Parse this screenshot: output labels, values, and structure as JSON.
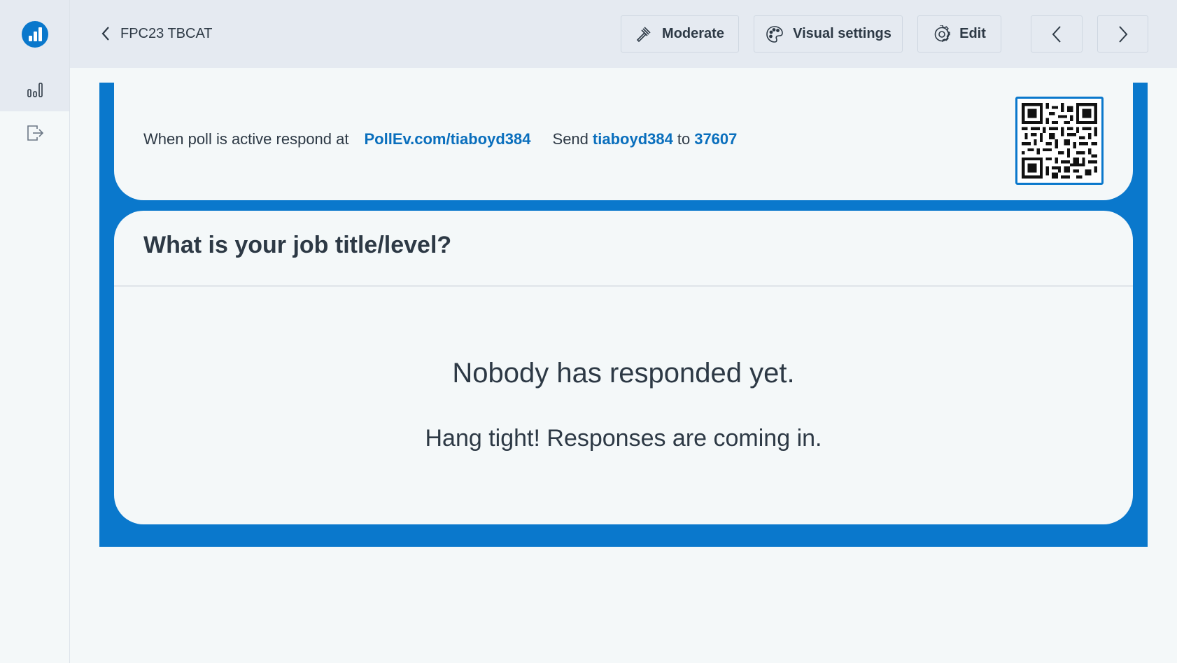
{
  "sidebar": {
    "logo_icon": "poll-everywhere-logo-icon",
    "items": [
      {
        "name": "bar-chart-icon",
        "active": true
      },
      {
        "name": "exit-icon",
        "active": false
      }
    ]
  },
  "header": {
    "back_label": "FPC23 TBCAT",
    "buttons": {
      "moderate": "Moderate",
      "visual_settings": "Visual settings",
      "edit": "Edit"
    }
  },
  "instructions": {
    "prefix": "When poll is active respond at",
    "url": "PollEv.com/tiaboyd384",
    "send": "Send",
    "keyword": "tiaboyd384",
    "to": "to",
    "number": "37607"
  },
  "question": {
    "title": "What is your job title/level?",
    "empty_main": "Nobody has responded yet.",
    "empty_sub": "Hang tight! Responses are coming in."
  },
  "colors": {
    "accent": "#0a78cc",
    "link": "#0a6fbd",
    "text": "#2d3945"
  }
}
